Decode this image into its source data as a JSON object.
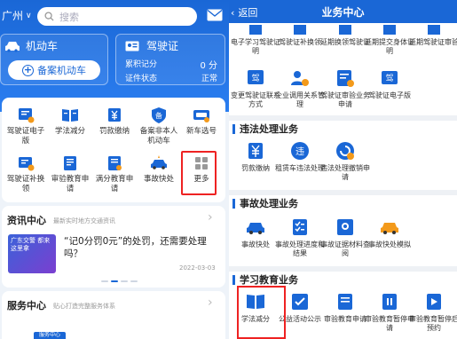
{
  "left": {
    "header": {
      "city": "广州",
      "search_placeholder": "搜索"
    },
    "vehicle_card": {
      "title": "机动车",
      "add_button": "备案机动车"
    },
    "license_card": {
      "title": "驾驶证",
      "points_label": "累积记分",
      "points_value": "0",
      "points_unit": "分",
      "status_label": "证件状态",
      "status_value": "正常"
    },
    "grid": [
      {
        "label": "驾驶证电子版",
        "icon": "license-ecard-icon"
      },
      {
        "label": "学法减分",
        "icon": "book-icon"
      },
      {
        "label": "罚款缴纳",
        "icon": "yen-icon"
      },
      {
        "label": "备案非本人机动车",
        "icon": "record-shield-icon"
      },
      {
        "label": "新车选号",
        "icon": "car-plate-icon"
      },
      {
        "label": "驾驶证补换领",
        "icon": "license-renew-icon"
      },
      {
        "label": "审验教育申请",
        "icon": "review-edu-icon"
      },
      {
        "label": "满分教育申请",
        "icon": "fullscore-edu-icon"
      },
      {
        "label": "事故快处",
        "icon": "car-accident-icon"
      },
      {
        "label": "更多",
        "icon": "more-grid-icon"
      }
    ],
    "news": {
      "title": "资讯中心",
      "subtitle": "最新实时地方交通资讯",
      "thumb_text": "广东交警 都来这里拿",
      "headline": "“记0分罚0元”的处罚，还需要处理吗？",
      "date": "2022-03-03"
    },
    "service": {
      "title": "服务中心",
      "subtitle": "贴心打造完整服务体系",
      "tag": "服务中心"
    }
  },
  "right": {
    "header": {
      "back": "返回",
      "title": "业务中心"
    },
    "top_items": [
      {
        "label": "电子学习驾驶证明"
      },
      {
        "label": "驾驶证补换领"
      },
      {
        "label": "延期换领驾驶证"
      },
      {
        "label": "延期提交身体证明"
      },
      {
        "label": "延期驾驶证审验"
      },
      {
        "label": "变更驾驶证联系方式"
      },
      {
        "label": "企业调用关系管理"
      },
      {
        "label": "驾驶证审验业务申请"
      },
      {
        "label": "驾驶证电子版"
      }
    ],
    "violation": {
      "title": "违法处理业务",
      "items": [
        {
          "label": "罚款缴纳"
        },
        {
          "label": "租赁车违法处理"
        },
        {
          "label": "违法处理撤销申请"
        }
      ]
    },
    "accident": {
      "title": "事故处理业务",
      "items": [
        {
          "label": "事故快处"
        },
        {
          "label": "事故处理进度和结果"
        },
        {
          "label": "事故证据材料查阅"
        },
        {
          "label": "事故快处模拟"
        }
      ]
    },
    "study": {
      "title": "学习教育业务",
      "items": [
        {
          "label": "学法减分"
        },
        {
          "label": "公益活动公示"
        },
        {
          "label": "审验教育申请"
        },
        {
          "label": "审验教育暂停申请"
        },
        {
          "label": "审验教育暂停后预约"
        }
      ]
    }
  },
  "colors": {
    "primary": "#1a67d6",
    "highlight": "#e22222",
    "orange": "#f39a1b"
  }
}
